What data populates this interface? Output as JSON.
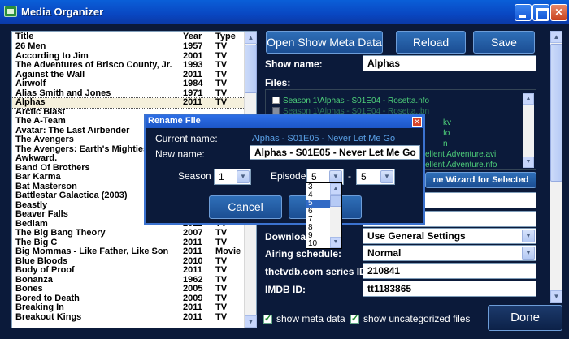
{
  "window": {
    "title": "Media Organizer"
  },
  "list": {
    "headers": {
      "title": "Title",
      "year": "Year",
      "type": "Type"
    },
    "rows": [
      [
        "26 Men",
        "1957",
        "TV"
      ],
      [
        "According to Jim",
        "2001",
        "TV"
      ],
      [
        "The Adventures of Brisco County, Jr.",
        "1993",
        "TV"
      ],
      [
        "Against the Wall",
        "2011",
        "TV"
      ],
      [
        "Airwolf",
        "1984",
        "TV"
      ],
      [
        "Alias Smith and Jones",
        "1971",
        "TV"
      ],
      [
        "Alphas",
        "2011",
        "TV"
      ],
      [
        "Arctic Blast",
        "",
        ""
      ],
      [
        "The A-Team",
        "",
        ""
      ],
      [
        "Avatar: The Last Airbender",
        "",
        ""
      ],
      [
        "The Avengers",
        "",
        ""
      ],
      [
        "The Avengers: Earth's Mightiest",
        "",
        ""
      ],
      [
        "Awkward.",
        "",
        ""
      ],
      [
        "Band Of Brothers",
        "",
        ""
      ],
      [
        "Bar Karma",
        "",
        ""
      ],
      [
        "Bat Masterson",
        "",
        ""
      ],
      [
        "Battlestar Galactica (2003)",
        "",
        ""
      ],
      [
        "Beastly",
        "",
        ""
      ],
      [
        "Beaver Falls",
        "",
        ""
      ],
      [
        "Bedlam",
        "2011",
        "TV"
      ],
      [
        "The Big Bang Theory",
        "2007",
        "TV"
      ],
      [
        "The Big C",
        "2011",
        "TV"
      ],
      [
        "Big Mommas - Like Father, Like Son",
        "2011",
        "Movie"
      ],
      [
        "Blue Bloods",
        "2010",
        "TV"
      ],
      [
        "Body of Proof",
        "2011",
        "TV"
      ],
      [
        "Bonanza",
        "1962",
        "TV"
      ],
      [
        "Bones",
        "2005",
        "TV"
      ],
      [
        "Bored to Death",
        "2009",
        "TV"
      ],
      [
        "Breaking In",
        "2011",
        "TV"
      ],
      [
        "Breakout Kings",
        "2011",
        "TV"
      ]
    ],
    "selected_index": 6
  },
  "right": {
    "open_meta_label": "Open Show Meta Data",
    "reload_label": "Reload",
    "save_label": "Save",
    "show_name_label": "Show name:",
    "show_name_value": "Alphas",
    "files_label": "Files:",
    "files": [
      "Season 1\\Alphas - S01E04 - Rosetta.nfo",
      "Season 1\\Alphas - S01E04 - Rosetta.tbn",
      "kv",
      "fo",
      "n",
      "ellent Adventure.avi",
      "ellent Adventure.nfo"
    ],
    "wizard_label": "ne Wizard for Selected",
    "download_label": "Download",
    "download_value": "Use General Settings",
    "airing_label": "Airing schedule:",
    "airing_value": "Normal",
    "tvdb_label": "thetvdb.com series ID:",
    "tvdb_value": "210841",
    "imdb_label": "IMDB ID:",
    "imdb_value": "tt1183865",
    "show_meta_label": "show meta data",
    "show_uncat_label": "show uncategorized files",
    "done_label": "Done"
  },
  "dialog": {
    "title": "Rename File",
    "current_label": "Current name:",
    "current_value": "Alphas - S01E05 - Never Let Me Go",
    "new_label": "New name:",
    "new_value": "Alphas - S01E05 - Never Let Me Go",
    "season_label": "Season",
    "season_value": "1",
    "episode_label": "Episode",
    "episode_value": "5",
    "dash": "-",
    "episode_end_value": "5",
    "cancel_label": "Cancel"
  },
  "episode_dropdown": {
    "options": [
      "3",
      "4",
      "5",
      "6",
      "7",
      "8",
      "9",
      "10"
    ],
    "highlighted": "5"
  },
  "icons": {
    "app": "app-icon",
    "dropdown_arrow": "chevron-down-icon",
    "scroll_up": "scroll-up-icon",
    "scroll_down": "scroll-down-icon",
    "close": "close-icon"
  }
}
